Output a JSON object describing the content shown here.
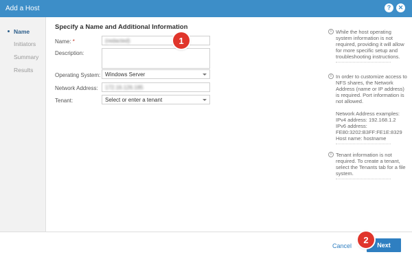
{
  "dialog": {
    "title": "Add a Host"
  },
  "header_icons": {
    "help": "?",
    "close": "⊗"
  },
  "steps": [
    {
      "label": "Name",
      "active": true
    },
    {
      "label": "Initiators",
      "active": false
    },
    {
      "label": "Summary",
      "active": false
    },
    {
      "label": "Results",
      "active": false
    }
  ],
  "form": {
    "heading": "Specify a Name and Additional Information",
    "name": {
      "label": "Name:",
      "required_mark": "*",
      "value": "(redacted)"
    },
    "description": {
      "label": "Description:",
      "value": ""
    },
    "os": {
      "label": "Operating System:",
      "value": "Windows Server"
    },
    "network": {
      "label": "Network Address:",
      "value": "172.16.126.185"
    },
    "tenant": {
      "label": "Tenant:",
      "value": "Select or enter a tenant"
    }
  },
  "help": {
    "os": "While the host operating system information is not required, providing it will allow for more specific setup and troubleshooting instructions.",
    "network_1": "In order to customize access to NFS shares, the Network Address (name or IP address) is required. Port information is not allowed.",
    "network_2": "Network Address examples:",
    "network_3": "IPv4 address: 192.168.1.2",
    "network_4": "IPv6 address: FE80:3202:B3FF:FE1E:8329",
    "network_5": "Host name: hostname",
    "tenant": "Tenant information is not required. To create a tenant, select the Tenants tab for a file system."
  },
  "footer": {
    "cancel": "Cancel",
    "next": "Next"
  },
  "callouts": {
    "one": "1",
    "two": "2"
  }
}
